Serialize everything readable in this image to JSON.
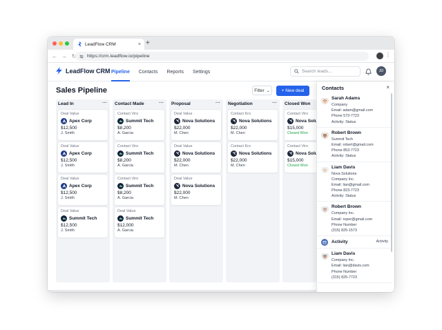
{
  "browser": {
    "tab_title": "LeadFlow CRM",
    "tab_close": "×",
    "new_tab": "+",
    "back": "←",
    "forward": "→",
    "reload": "↻",
    "url": "https://crm.leadflow.io/pipeline",
    "menu": "⋮"
  },
  "app": {
    "brand": "LeadFlow CRM",
    "nav": [
      "Pipeline",
      "Contacts",
      "Reports",
      "Settings"
    ],
    "active_nav": "Pipeline",
    "search_placeholder": "Search leads...",
    "avatar_initials": "JD"
  },
  "page": {
    "title": "Sales Pipeline",
    "filter_label": "Filter",
    "filter_caret": "⌄",
    "new_deal_label": "+ New deal"
  },
  "columns": [
    {
      "title": "Lead In",
      "more": "···",
      "cards": [
        {
          "label": "Deal Value",
          "company": "Apex Corp",
          "logo": "apex",
          "amount": "$12,500",
          "owner": "J. Smith"
        },
        {
          "label": "Deal Value",
          "company": "Apex Corp",
          "logo": "apex",
          "amount": "$12,500",
          "owner": "J. Smith"
        },
        {
          "label": "Deal Value",
          "company": "Apex Corp",
          "logo": "apex",
          "amount": "$12,500",
          "owner": "J. Smith"
        },
        {
          "label": "Deal Value",
          "company": "Summit Tech",
          "logo": "summit",
          "amount": "$12,500",
          "owner": "J. Smith"
        }
      ]
    },
    {
      "title": "Contact Made",
      "more": "···",
      "cards": [
        {
          "label": "Contact Viro",
          "company": "Summit Tech",
          "logo": "summit",
          "amount": "$8,200",
          "owner": "A. Garcia"
        },
        {
          "label": "Contact Viro",
          "company": "Summit Tech",
          "logo": "summit",
          "amount": "$8,200",
          "owner": "A. Garcia"
        },
        {
          "label": "Contact Viro",
          "company": "Summit Tech",
          "logo": "summit",
          "amount": "$8,200",
          "owner": "A. Garcia"
        },
        {
          "label": "Deal Value",
          "company": "Summit Tech",
          "logo": "summit",
          "amount": "$12,000",
          "owner": "A. Garcia"
        }
      ]
    },
    {
      "title": "Proposal",
      "more": "···",
      "cards": [
        {
          "label": "Deal Value",
          "company": "Nova Solutions",
          "logo": "nova",
          "amount": "$22,000",
          "owner": "M. Chen"
        },
        {
          "label": "Deal Value",
          "company": "Nova Solutions",
          "logo": "nova",
          "amount": "$22,000",
          "owner": "M. Chen"
        },
        {
          "label": "Deal Value",
          "company": "Nova Solutions",
          "logo": "nova",
          "amount": "$22,000",
          "owner": "M. Chen"
        }
      ]
    },
    {
      "title": "Negotiation",
      "more": "···",
      "cards": [
        {
          "label": "Contact Kro",
          "company": "Nova Solutions",
          "logo": "nova",
          "amount": "$22,000",
          "owner": "M. Chen"
        },
        {
          "label": "Contact Kro",
          "company": "Nova Solutions",
          "logo": "nova",
          "amount": "$22,000",
          "owner": "M. Chen"
        }
      ]
    },
    {
      "title": "Closed Won",
      "more": "",
      "cards": [
        {
          "label": "Contact Viro",
          "company": "Nova Solutions",
          "logo": "nova",
          "amount": "$15,000",
          "owner": "Closed Won",
          "won": true
        },
        {
          "label": "Contact Viro",
          "company": "Nova Solutions",
          "logo": "nova",
          "amount": "$15,000",
          "owner": "Closed Won",
          "won": true
        }
      ]
    }
  ],
  "contacts_panel": {
    "title": "Contacts",
    "close": "×",
    "contacts": [
      {
        "name": "Sarah Adams",
        "avatar": "woman",
        "lines": [
          "Company",
          "Email: adam@gmail.com",
          "Phone 573-7723",
          "Activity: Status"
        ]
      },
      {
        "name": "Robert Brown",
        "avatar": "man-dark",
        "lines": [
          "Summit Tech",
          "Email: robert@gmail.com",
          "Phone 853-7723",
          "Activity: Status"
        ]
      },
      {
        "name": "Liam Davis",
        "avatar": "man-light",
        "lines": [
          "Nova Solutions",
          "Company Inc.",
          "Email: lian@gmail.com",
          "Phone 823-7723",
          "Activity: Status"
        ]
      },
      {
        "name": "Robert Brown",
        "avatar": "man-grey",
        "lines": [
          "Company Inc.",
          "Email: roper@gmail.com",
          "Phone Number",
          "(315) 825-1573"
        ]
      }
    ],
    "activity": {
      "label": "Activity",
      "right": "Activity"
    },
    "contacts_after": [
      {
        "name": "Liam Davis",
        "avatar": "man-dark2",
        "lines": [
          "Company Inc.",
          "Email: lian@davis.com",
          "Phone Number",
          "(315) 825-7723"
        ]
      }
    ]
  },
  "colors": {
    "accent": "#2563eb",
    "won": "#16a34a",
    "apex_logo": "#1e3a8a",
    "summit_logo": "#14213d",
    "nova_logo": "#1e293b"
  }
}
